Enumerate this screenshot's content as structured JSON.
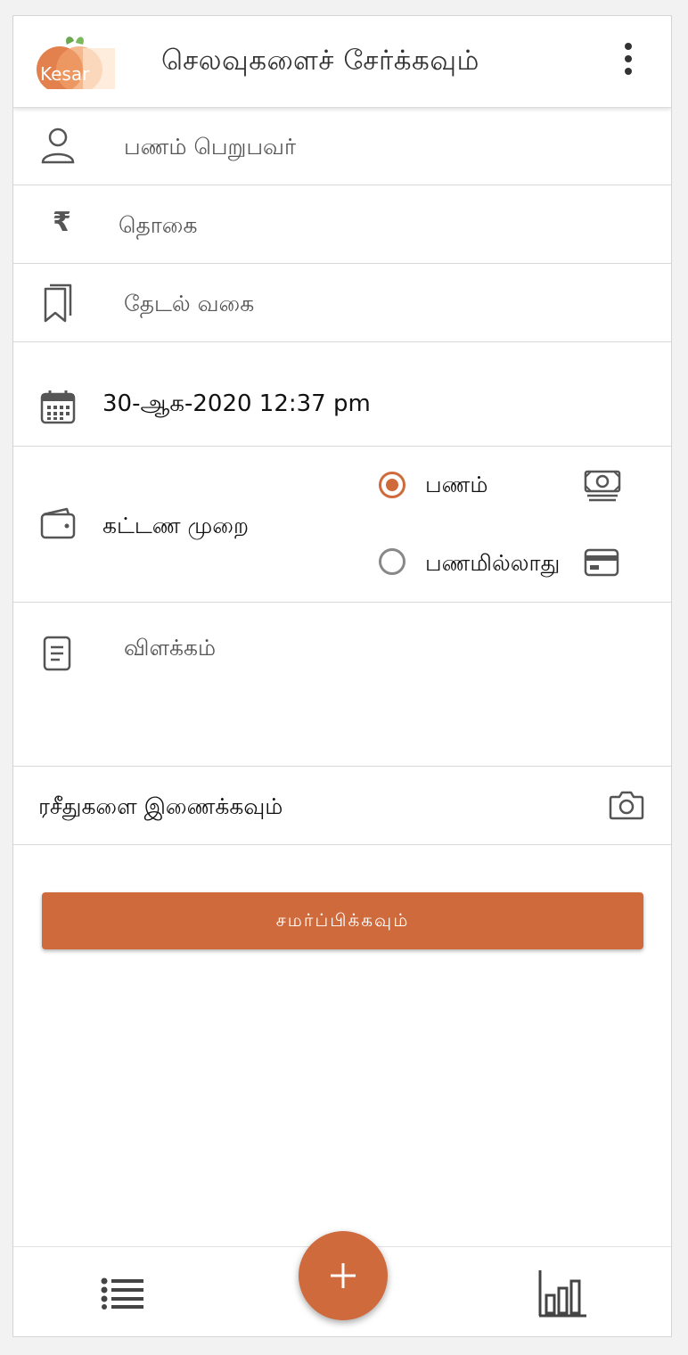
{
  "header": {
    "logo_text": "Kesar",
    "title": "செலவுகளைச் சேர்க்கவும்"
  },
  "form": {
    "payee": {
      "placeholder": "பணம் பெறுபவர்"
    },
    "amount": {
      "placeholder": "தொகை",
      "currency_symbol": "₹"
    },
    "category": {
      "placeholder": "தேடல் வகை"
    },
    "datetime": {
      "value": "30-ஆக-2020 12:37 pm"
    },
    "payment_mode": {
      "label": "கட்டண முறை",
      "options": [
        {
          "label": "பணம்",
          "selected": true,
          "icon": "cash-icon"
        },
        {
          "label": "பணமில்லாது",
          "selected": false,
          "icon": "card-icon"
        }
      ]
    },
    "description": {
      "placeholder": "விளக்கம்"
    },
    "receipts": {
      "label": "ரசீதுகளை இணைக்கவும்"
    },
    "submit_label": "சமர்ப்பிக்கவும்"
  },
  "colors": {
    "accent": "#cf6a3c",
    "logo_fill": "#e88a4f",
    "leaf": "#6aa84f"
  },
  "bottom_nav": {
    "left_icon": "list-icon",
    "center_icon": "plus-icon",
    "right_icon": "bar-chart-icon"
  }
}
